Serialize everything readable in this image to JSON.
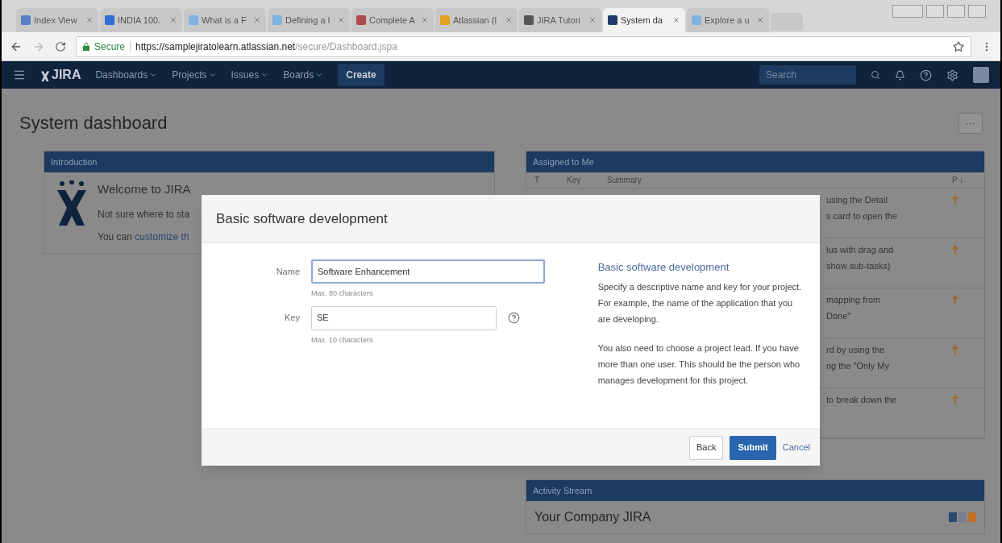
{
  "browser": {
    "tabs": [
      {
        "title": "Index View",
        "selected": false,
        "color": "#5b7fc7"
      },
      {
        "title": "INDIA 100.",
        "selected": false,
        "color": "#2f6fd6"
      },
      {
        "title": "What is a F",
        "selected": false,
        "color": "#7fb3e0"
      },
      {
        "title": "Defining a I",
        "selected": false,
        "color": "#7fb3e0"
      },
      {
        "title": "Complete A",
        "selected": false,
        "color": "#b04a4a"
      },
      {
        "title": "Atlassian (I",
        "selected": false,
        "color": "#e6a020"
      },
      {
        "title": "JIRA Tutori",
        "selected": false,
        "color": "#555555"
      },
      {
        "title": "System da",
        "selected": true,
        "color": "#1f3a6c"
      },
      {
        "title": "Explore a u",
        "selected": false,
        "color": "#7fb3e0"
      }
    ],
    "secure_label": "Secure",
    "url_host": "https://samplejiratolearn.atlassian.net",
    "url_path": "/secure/Dashboard.jspa"
  },
  "nav": {
    "logo": "JIRA",
    "menus": [
      "Dashboards",
      "Projects",
      "Issues",
      "Boards"
    ],
    "create": "Create",
    "search_placeholder": "Search"
  },
  "page": {
    "title": "System dashboard",
    "more": "···"
  },
  "introduction": {
    "title": "Introduction",
    "heading": "Welcome to JIRA",
    "line_1": "Not sure where to sta",
    "line_2_prefix": "You can ",
    "line_2_link": "customize th"
  },
  "assigned": {
    "title": "Assigned to Me",
    "columns": [
      "T",
      "Key",
      "Summary",
      "P ↓"
    ],
    "rows": [
      {
        "summary_lines": [
          "using the Detail",
          "s card to open the"
        ]
      },
      {
        "summary_lines": [
          "lus with drag and",
          "show sub-tasks)"
        ]
      },
      {
        "summary_lines": [
          "mapping from",
          "Done\""
        ]
      },
      {
        "summary_lines": [
          "rd by using the",
          "ng the \"Only My"
        ]
      },
      {
        "summary_lines": [
          "to break down the"
        ]
      }
    ]
  },
  "activity": {
    "title": "Activity Stream",
    "heading": "Your Company JIRA"
  },
  "modal": {
    "title": "Basic software development",
    "fields": [
      {
        "label": "Name",
        "value": "Software Enhancement",
        "hint": "Max. 80 characters",
        "focused": true,
        "help": false
      },
      {
        "label": "Key",
        "value": "SE",
        "hint": "Max. 10 characters",
        "focused": false,
        "help": true
      }
    ],
    "aside": {
      "heading": "Basic software development",
      "paragraphs": [
        "Specify a descriptive name and key for your project. For example, the name of the application that you are developing.",
        "You also need to choose a project lead. If you have more than one user. This should be the person who manages development for this project."
      ]
    },
    "back": "Back",
    "submit": "Submit",
    "cancel": "Cancel"
  }
}
